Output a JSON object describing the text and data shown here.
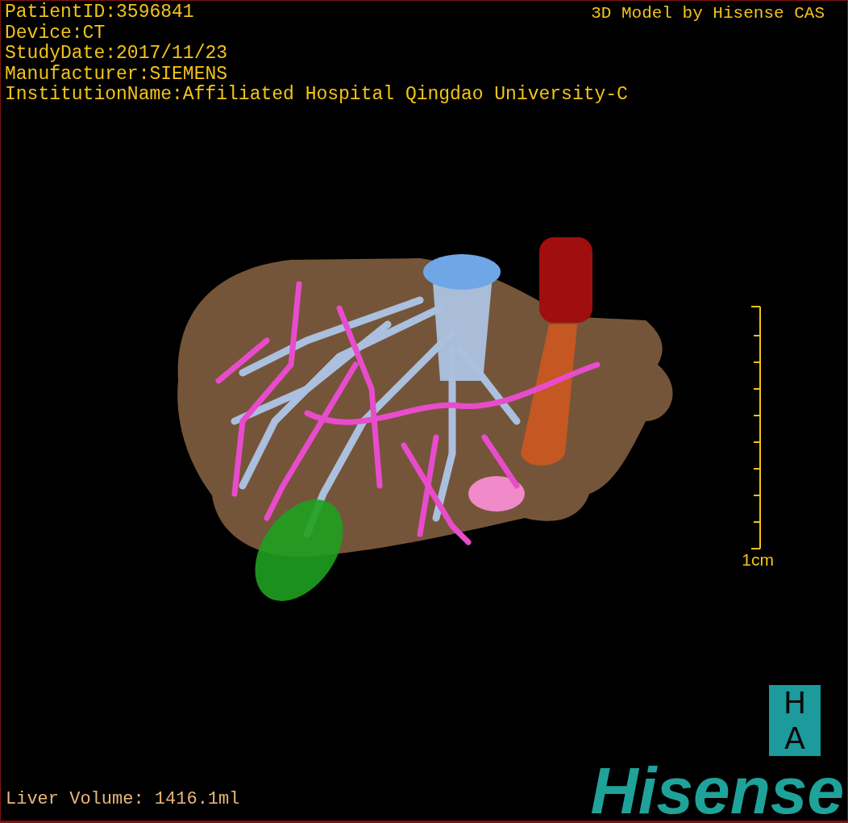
{
  "study_info": [
    "PatientID:3596841",
    "Device:CT",
    "StudyDate:2017/11/23",
    "Manufacturer:SIEMENS",
    "InstitutionName:Affiliated Hospital Qingdao University-C"
  ],
  "viewer_title": "3D Model by Hisense CAS",
  "scale_bar": {
    "label": "1cm"
  },
  "liver_volume": "Liver Volume: 1416.1ml",
  "logo": {
    "badge_letters": [
      "H",
      "A"
    ],
    "wordmark": "Hisense"
  }
}
